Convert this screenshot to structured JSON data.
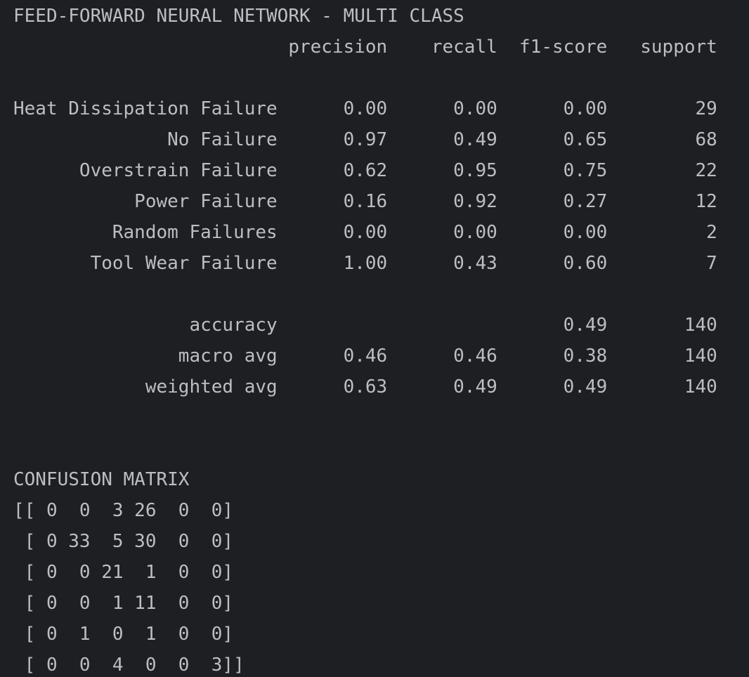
{
  "report_title": "FEED-FORWARD NEURAL NETWORK - MULTI CLASS",
  "columns": [
    "precision",
    "recall",
    "f1-score",
    "support"
  ],
  "rows": [
    {
      "label": "Heat Dissipation Failure",
      "precision": "0.00",
      "recall": "0.00",
      "f1": "0.00",
      "support": "29"
    },
    {
      "label": "No Failure",
      "precision": "0.97",
      "recall": "0.49",
      "f1": "0.65",
      "support": "68"
    },
    {
      "label": "Overstrain Failure",
      "precision": "0.62",
      "recall": "0.95",
      "f1": "0.75",
      "support": "22"
    },
    {
      "label": "Power Failure",
      "precision": "0.16",
      "recall": "0.92",
      "f1": "0.27",
      "support": "12"
    },
    {
      "label": "Random Failures",
      "precision": "0.00",
      "recall": "0.00",
      "f1": "0.00",
      "support": "2"
    },
    {
      "label": "Tool Wear Failure",
      "precision": "1.00",
      "recall": "0.43",
      "f1": "0.60",
      "support": "7"
    }
  ],
  "summary": [
    {
      "label": "accuracy",
      "precision": "",
      "recall": "",
      "f1": "0.49",
      "support": "140"
    },
    {
      "label": "macro avg",
      "precision": "0.46",
      "recall": "0.46",
      "f1": "0.38",
      "support": "140"
    },
    {
      "label": "weighted avg",
      "precision": "0.63",
      "recall": "0.49",
      "f1": "0.49",
      "support": "140"
    }
  ],
  "confusion_title": "CONFUSION MATRIX",
  "confusion_matrix": [
    [
      0,
      0,
      3,
      26,
      0,
      0
    ],
    [
      0,
      33,
      5,
      30,
      0,
      0
    ],
    [
      0,
      0,
      21,
      1,
      0,
      0
    ],
    [
      0,
      0,
      1,
      11,
      0,
      0
    ],
    [
      0,
      1,
      0,
      1,
      0,
      0
    ],
    [
      0,
      0,
      4,
      0,
      0,
      3
    ]
  ],
  "colors": {
    "background": "#1e1f22",
    "text": "#bcbec4"
  }
}
